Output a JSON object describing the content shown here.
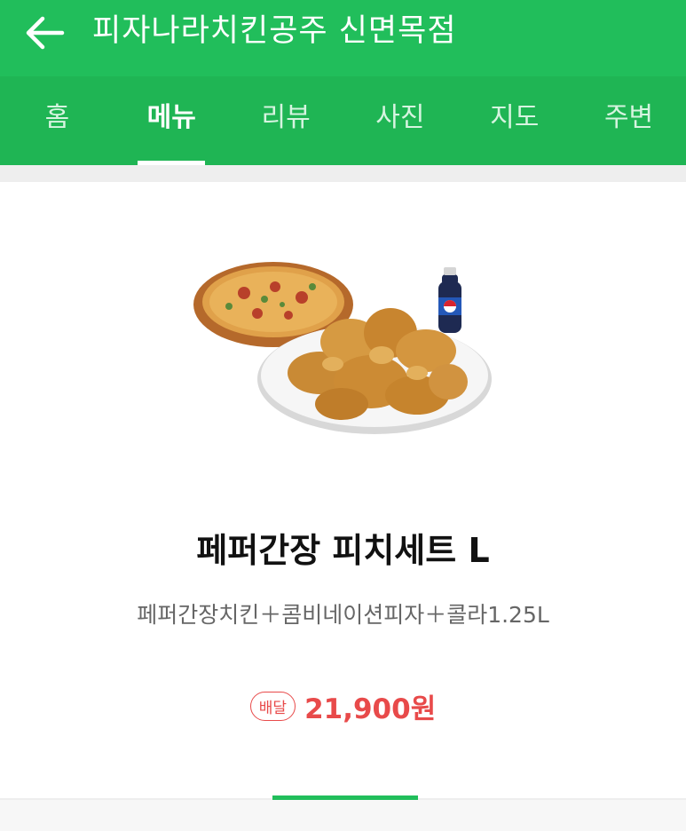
{
  "header": {
    "title": "피자나라치킨공주 신면목점"
  },
  "tabs": [
    {
      "label": "홈"
    },
    {
      "label": "메뉴"
    },
    {
      "label": "리뷰"
    },
    {
      "label": "사진"
    },
    {
      "label": "지도"
    },
    {
      "label": "주변"
    }
  ],
  "active_tab": "메뉴",
  "menu_item": {
    "name": "페퍼간장 피치세트 L",
    "description": "페퍼간장치킨＋콤비네이션피자＋콜라1.25L",
    "order_type_badge": "배달",
    "price": "21,900원"
  },
  "icons": [
    "back-arrow-icon"
  ],
  "colors": {
    "brand_green": "#21be5b",
    "price_red": "#e84a4a"
  }
}
